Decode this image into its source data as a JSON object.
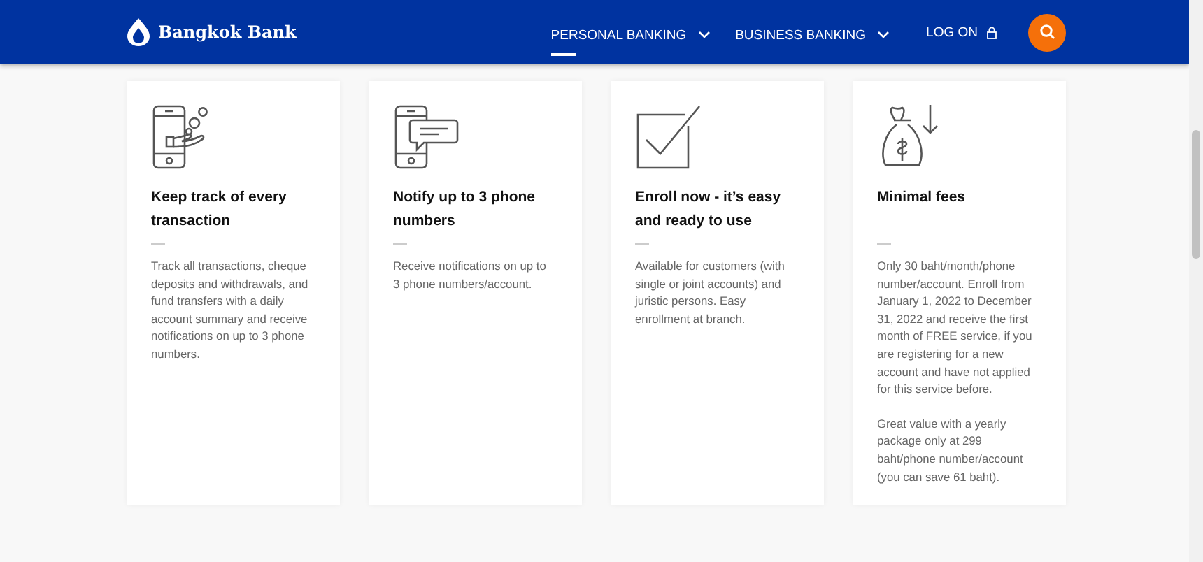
{
  "header": {
    "logo": "Bangkok Bank",
    "nav": [
      {
        "label": "PERSONAL BANKING",
        "selected": true
      },
      {
        "label": "BUSINESS BANKING",
        "selected": false
      }
    ],
    "login": "LOG ON"
  },
  "cards": [
    {
      "title": "Keep track of every transaction",
      "paragraphs": [
        "Track all transactions, cheque deposits and withdrawals, and fund transfers with a daily account summary and receive notifications on up to 3 phone numbers."
      ]
    },
    {
      "title": "Notify up to 3 phone numbers",
      "paragraphs": [
        "Receive notifications on up to 3 phone numbers/account."
      ]
    },
    {
      "title": "Enroll now - it’s easy and ready to use",
      "paragraphs": [
        "Available for customers (with single or joint accounts) and juristic persons. Easy enrollment at branch."
      ]
    },
    {
      "title": "Minimal fees",
      "paragraphs": [
        "Only 30 baht/month/phone number/account. Enroll from January 1, 2022 to December 31, 2022 and receive the first month of FREE service, if you are registering for a new account and have not applied for this service before.",
        "Great value with a yearly package only at 299 baht/phone number/account (you can save 61 baht)."
      ]
    }
  ]
}
